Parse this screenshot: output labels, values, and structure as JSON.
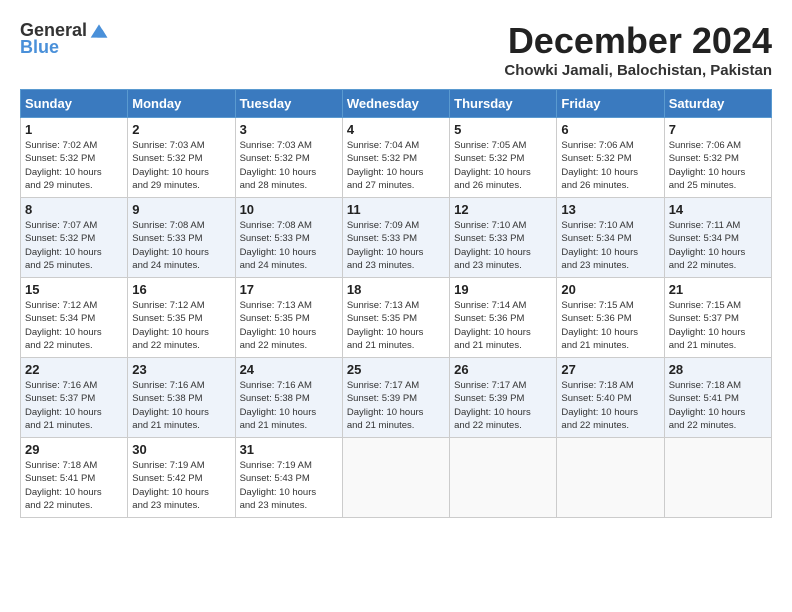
{
  "logo": {
    "general": "General",
    "blue": "Blue"
  },
  "title": "December 2024",
  "subtitle": "Chowki Jamali, Balochistan, Pakistan",
  "headers": [
    "Sunday",
    "Monday",
    "Tuesday",
    "Wednesday",
    "Thursday",
    "Friday",
    "Saturday"
  ],
  "weeks": [
    [
      {
        "day": "1",
        "sunrise": "7:02 AM",
        "sunset": "5:32 PM",
        "daylight": "10 hours and 29 minutes."
      },
      {
        "day": "2",
        "sunrise": "7:03 AM",
        "sunset": "5:32 PM",
        "daylight": "10 hours and 29 minutes."
      },
      {
        "day": "3",
        "sunrise": "7:03 AM",
        "sunset": "5:32 PM",
        "daylight": "10 hours and 28 minutes."
      },
      {
        "day": "4",
        "sunrise": "7:04 AM",
        "sunset": "5:32 PM",
        "daylight": "10 hours and 27 minutes."
      },
      {
        "day": "5",
        "sunrise": "7:05 AM",
        "sunset": "5:32 PM",
        "daylight": "10 hours and 26 minutes."
      },
      {
        "day": "6",
        "sunrise": "7:06 AM",
        "sunset": "5:32 PM",
        "daylight": "10 hours and 26 minutes."
      },
      {
        "day": "7",
        "sunrise": "7:06 AM",
        "sunset": "5:32 PM",
        "daylight": "10 hours and 25 minutes."
      }
    ],
    [
      {
        "day": "8",
        "sunrise": "7:07 AM",
        "sunset": "5:32 PM",
        "daylight": "10 hours and 25 minutes."
      },
      {
        "day": "9",
        "sunrise": "7:08 AM",
        "sunset": "5:33 PM",
        "daylight": "10 hours and 24 minutes."
      },
      {
        "day": "10",
        "sunrise": "7:08 AM",
        "sunset": "5:33 PM",
        "daylight": "10 hours and 24 minutes."
      },
      {
        "day": "11",
        "sunrise": "7:09 AM",
        "sunset": "5:33 PM",
        "daylight": "10 hours and 23 minutes."
      },
      {
        "day": "12",
        "sunrise": "7:10 AM",
        "sunset": "5:33 PM",
        "daylight": "10 hours and 23 minutes."
      },
      {
        "day": "13",
        "sunrise": "7:10 AM",
        "sunset": "5:34 PM",
        "daylight": "10 hours and 23 minutes."
      },
      {
        "day": "14",
        "sunrise": "7:11 AM",
        "sunset": "5:34 PM",
        "daylight": "10 hours and 22 minutes."
      }
    ],
    [
      {
        "day": "15",
        "sunrise": "7:12 AM",
        "sunset": "5:34 PM",
        "daylight": "10 hours and 22 minutes."
      },
      {
        "day": "16",
        "sunrise": "7:12 AM",
        "sunset": "5:35 PM",
        "daylight": "10 hours and 22 minutes."
      },
      {
        "day": "17",
        "sunrise": "7:13 AM",
        "sunset": "5:35 PM",
        "daylight": "10 hours and 22 minutes."
      },
      {
        "day": "18",
        "sunrise": "7:13 AM",
        "sunset": "5:35 PM",
        "daylight": "10 hours and 21 minutes."
      },
      {
        "day": "19",
        "sunrise": "7:14 AM",
        "sunset": "5:36 PM",
        "daylight": "10 hours and 21 minutes."
      },
      {
        "day": "20",
        "sunrise": "7:15 AM",
        "sunset": "5:36 PM",
        "daylight": "10 hours and 21 minutes."
      },
      {
        "day": "21",
        "sunrise": "7:15 AM",
        "sunset": "5:37 PM",
        "daylight": "10 hours and 21 minutes."
      }
    ],
    [
      {
        "day": "22",
        "sunrise": "7:16 AM",
        "sunset": "5:37 PM",
        "daylight": "10 hours and 21 minutes."
      },
      {
        "day": "23",
        "sunrise": "7:16 AM",
        "sunset": "5:38 PM",
        "daylight": "10 hours and 21 minutes."
      },
      {
        "day": "24",
        "sunrise": "7:16 AM",
        "sunset": "5:38 PM",
        "daylight": "10 hours and 21 minutes."
      },
      {
        "day": "25",
        "sunrise": "7:17 AM",
        "sunset": "5:39 PM",
        "daylight": "10 hours and 21 minutes."
      },
      {
        "day": "26",
        "sunrise": "7:17 AM",
        "sunset": "5:39 PM",
        "daylight": "10 hours and 22 minutes."
      },
      {
        "day": "27",
        "sunrise": "7:18 AM",
        "sunset": "5:40 PM",
        "daylight": "10 hours and 22 minutes."
      },
      {
        "day": "28",
        "sunrise": "7:18 AM",
        "sunset": "5:41 PM",
        "daylight": "10 hours and 22 minutes."
      }
    ],
    [
      {
        "day": "29",
        "sunrise": "7:18 AM",
        "sunset": "5:41 PM",
        "daylight": "10 hours and 22 minutes."
      },
      {
        "day": "30",
        "sunrise": "7:19 AM",
        "sunset": "5:42 PM",
        "daylight": "10 hours and 23 minutes."
      },
      {
        "day": "31",
        "sunrise": "7:19 AM",
        "sunset": "5:43 PM",
        "daylight": "10 hours and 23 minutes."
      },
      null,
      null,
      null,
      null
    ]
  ],
  "labels": {
    "sunrise": "Sunrise:",
    "sunset": "Sunset:",
    "daylight": "Daylight:"
  }
}
